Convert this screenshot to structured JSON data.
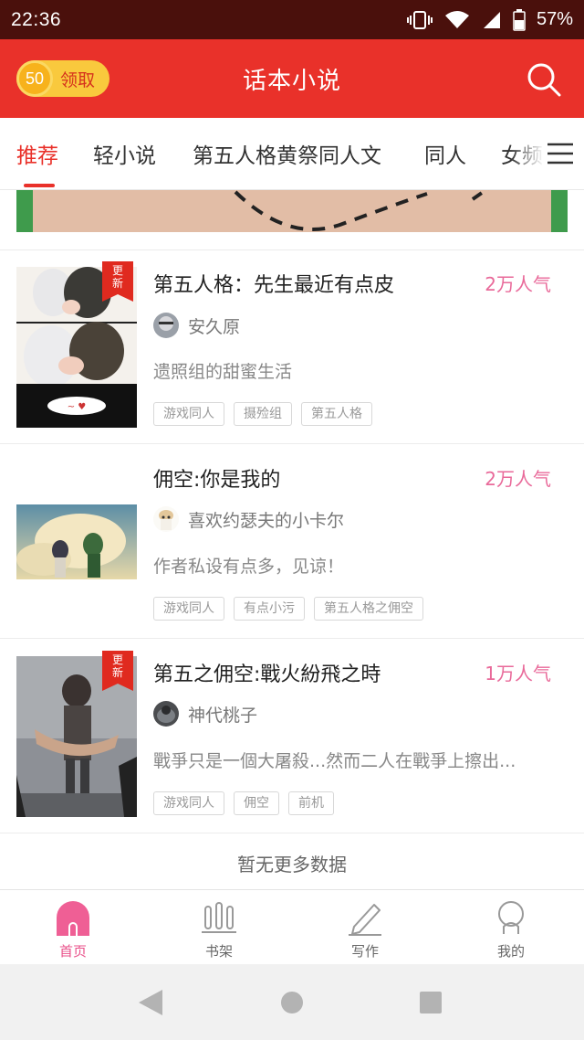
{
  "status_bar": {
    "time": "22:36",
    "battery": "57%"
  },
  "header": {
    "coin_value": "50",
    "coin_label": "领取",
    "title": "话本小说"
  },
  "tabs": [
    {
      "label": "推荐",
      "active": true
    },
    {
      "label": "轻小说",
      "active": false
    },
    {
      "label": "第五人格黄祭同人文",
      "active": false
    },
    {
      "label": "同人",
      "active": false
    },
    {
      "label": "女频",
      "active": false
    }
  ],
  "books": [
    {
      "badge": "更新",
      "title": "第五人格：先生最近有点皮",
      "popularity": "2万人气",
      "author": "安久原",
      "description": "遗照组的甜蜜生活",
      "tags": [
        "游戏同人",
        "摄殓组",
        "第五人格"
      ]
    },
    {
      "badge": "",
      "title": "佣空:你是我的",
      "popularity": "2万人气",
      "author": "喜欢约瑟夫的小卡尔",
      "description": "作者私设有点多，见谅！",
      "tags": [
        "游戏同人",
        "有点小污",
        "第五人格之佣空"
      ]
    },
    {
      "badge": "更新",
      "title": "第五之佣空:戰火紛飛之時",
      "popularity": "1万人气",
      "author": "神代桃子",
      "description": "戰爭只是一個大屠殺...然而二人在戰爭上擦出...",
      "tags": [
        "游戏同人",
        "佣空",
        "前机"
      ]
    }
  ],
  "no_more": "暂无更多数据",
  "bottom_nav": [
    {
      "label": "首页",
      "icon": "home-icon",
      "active": true
    },
    {
      "label": "书架",
      "icon": "bookshelf-icon",
      "active": false
    },
    {
      "label": "写作",
      "icon": "write-icon",
      "active": false
    },
    {
      "label": "我的",
      "icon": "profile-icon",
      "active": false
    }
  ],
  "colors": {
    "accent": "#e9312a",
    "popularity": "#e96a9a",
    "status_bar": "#4a100c"
  }
}
